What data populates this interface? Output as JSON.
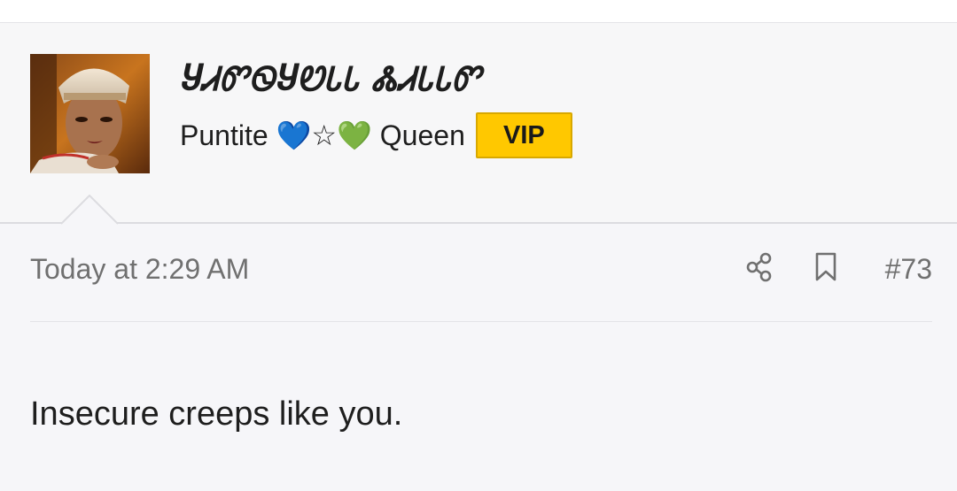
{
  "user": {
    "username": "ႸᏗᏛᏫႸᏬᏓᏓ ᏜᏗᏓᏓᏛ",
    "title": "Puntite 💙☆💚 Queen",
    "badge": "VIP",
    "avatar": "avatar-portrait"
  },
  "post": {
    "timestamp": "Today at 2:29 AM",
    "post_number": "#73",
    "body": "Insecure creeps like you.",
    "actions": {
      "share_icon": "share-icon",
      "bookmark_icon": "bookmark-icon"
    }
  },
  "colors": {
    "badge_bg": "#ffc800",
    "meta_text": "#707070",
    "page_bg": "#f6f6f9"
  }
}
